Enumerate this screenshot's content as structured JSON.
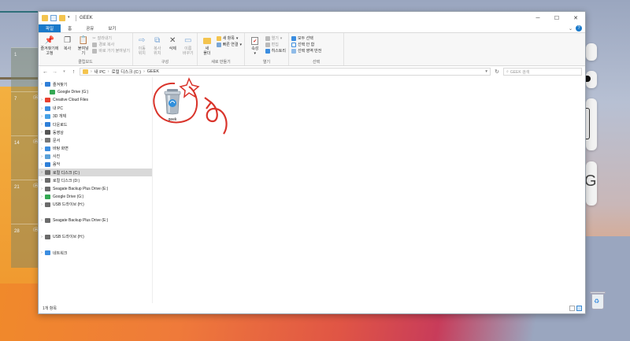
{
  "window": {
    "title": "GEEK",
    "tabs": [
      "파일",
      "홈",
      "공유",
      "보기"
    ],
    "ribbon": {
      "clipboard": {
        "label": "클립보드",
        "pin": "즐겨찾기에\n고정",
        "copy": "복사",
        "paste": "붙여넣기",
        "cut": "잘라내기",
        "copy_path": "경로 복사",
        "paste_shortcut": "바로 가기 붙여넣기"
      },
      "organize": {
        "label": "구성",
        "move_to": "이동\n위치",
        "copy_to": "복사\n위치",
        "delete": "삭제",
        "rename": "이름\n바꾸기"
      },
      "new": {
        "label": "새로 만들기",
        "new_folder": "새\n폴더",
        "new_item": "새 항목",
        "easy_access": "빠른 연결"
      },
      "open": {
        "label": "열기",
        "properties": "속성",
        "open": "열기",
        "edit": "편집",
        "history": "히스토리"
      },
      "select": {
        "label": "선택",
        "select_all": "모두 선택",
        "select_none": "선택 안 함",
        "invert": "선택 영역 반전"
      }
    },
    "address": {
      "crumbs": [
        "내 PC",
        "로컬 디스크 (C:)",
        "GEEK"
      ],
      "search_placeholder": "GEEK 검색"
    },
    "sidebar": [
      {
        "label": "즐겨찾기",
        "icon": "star-icon",
        "color": "#2f7fd8",
        "expand": true
      },
      {
        "label": "Google Drive (G:)",
        "icon": "google-drive-icon",
        "color": "#34a853",
        "expand": false
      },
      {
        "label": "Creative Cloud Files",
        "icon": "creative-cloud-icon",
        "color": "#e8402f",
        "expand": true
      },
      {
        "label": "내 PC",
        "icon": "pc-icon",
        "color": "#3b8de0",
        "expand": true
      },
      {
        "label": "3D 개체",
        "icon": "cube-icon",
        "color": "#46a0e6",
        "expand": true
      },
      {
        "label": "다운로드",
        "icon": "download-icon",
        "color": "#2f7fd8",
        "expand": true
      },
      {
        "label": "동영상",
        "icon": "video-icon",
        "color": "#555555",
        "expand": true
      },
      {
        "label": "문서",
        "icon": "document-icon",
        "color": "#777777",
        "expand": true
      },
      {
        "label": "바탕 화면",
        "icon": "desktop-icon",
        "color": "#3b8de0",
        "expand": true
      },
      {
        "label": "사진",
        "icon": "picture-icon",
        "color": "#5aa0d8",
        "expand": true
      },
      {
        "label": "음악",
        "icon": "music-icon",
        "color": "#2f7fd8",
        "expand": true
      },
      {
        "label": "로컬 디스크 (C:)",
        "icon": "drive-icon",
        "color": "#6b6b6b",
        "expand": true,
        "selected": true
      },
      {
        "label": "로컬 디스크 (D:)",
        "icon": "drive-icon",
        "color": "#6b6b6b",
        "expand": true
      },
      {
        "label": "Seagate Backup Plus Drive (E:)",
        "icon": "drive-icon",
        "color": "#6b6b6b",
        "expand": true
      },
      {
        "label": "Google Drive (G:)",
        "icon": "google-drive-icon",
        "color": "#34a853",
        "expand": true
      },
      {
        "label": "USB 드라이브 (H:)",
        "icon": "usb-icon",
        "color": "#6b6b6b",
        "expand": true
      },
      {
        "label": "",
        "icon": "",
        "color": "",
        "expand": false,
        "spacer": true
      },
      {
        "label": "Seagate Backup Plus Drive (E:)",
        "icon": "drive-icon",
        "color": "#6b6b6b",
        "expand": true
      },
      {
        "label": "",
        "icon": "",
        "color": "",
        "expand": false,
        "spacer": true
      },
      {
        "label": "USB 드라이브 (H:)",
        "icon": "usb-icon",
        "color": "#6b6b6b",
        "expand": true
      },
      {
        "label": "",
        "icon": "",
        "color": "",
        "expand": false,
        "spacer": true
      },
      {
        "label": "네트워크",
        "icon": "network-icon",
        "color": "#3b8de0",
        "expand": true
      }
    ],
    "files": [
      {
        "name": "geek"
      }
    ],
    "status": "1개 항목"
  },
  "desktop": {
    "calendar": [
      {
        "num": "1",
        "date": ""
      },
      {
        "num": "7",
        "date": "(음)..."
      },
      {
        "num": "14",
        "date": "(음)..."
      },
      {
        "num": "21",
        "date": "(음)..."
      },
      {
        "num": "28",
        "date": "(음)..."
      }
    ],
    "widget_letter": "G"
  },
  "colors": {
    "accent": "#1979ca",
    "annotation": "#d9342b",
    "folder": "#f4c44e"
  }
}
